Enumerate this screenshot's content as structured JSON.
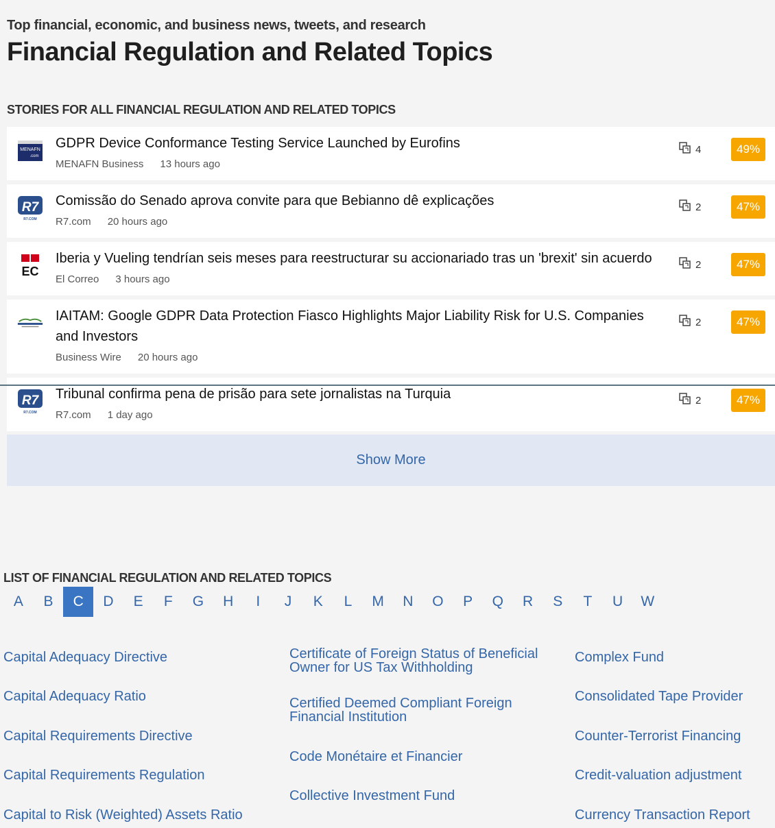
{
  "header": {
    "subtitle": "Top financial, economic, and business news, tweets, and research",
    "title": "Financial Regulation and Related Topics"
  },
  "stories_section": {
    "heading": "STORIES FOR ALL FINANCIAL REGULATION AND RELATED TOPICS",
    "show_more_label": "Show More",
    "stories": [
      {
        "title": "GDPR Device Conformance Testing Service Launched by Eurofins",
        "source": "MENAFN Business",
        "time": "13 hours ago",
        "count": "4",
        "percent": "49%",
        "logo": "menafn-logo"
      },
      {
        "title": "Comissão do Senado aprova convite para que Bebianno dê explicações",
        "source": "R7.com",
        "time": "20 hours ago",
        "count": "2",
        "percent": "47%",
        "logo": "r7-logo"
      },
      {
        "title": "Iberia y Vueling tendrían seis meses para reestructurar su accionariado tras un 'brexit' sin acuerdo",
        "source": "El Correo",
        "time": "3 hours ago",
        "count": "2",
        "percent": "47%",
        "logo": "el-correo-logo"
      },
      {
        "title": "IAITAM: Google GDPR Data Protection Fiasco Highlights Major Liability Risk for U.S. Companies and Investors",
        "source": "Business Wire",
        "time": "20 hours ago",
        "count": "2",
        "percent": "47%",
        "logo": "business-wire-logo"
      },
      {
        "title": "Tribunal confirma pena de prisão para sete jornalistas na Turquia",
        "source": "R7.com",
        "time": "1 day ago",
        "count": "2",
        "percent": "47%",
        "logo": "r7-logo"
      }
    ]
  },
  "logos": {
    "menafn": {
      "line1": "MENAFN",
      "line2": ".com"
    },
    "r7": {
      "main": "R7",
      "sub": "R7.COM"
    },
    "el_correo": {
      "text": "EC"
    }
  },
  "topics_section": {
    "heading": "LIST OF FINANCIAL REGULATION AND RELATED TOPICS",
    "letters": [
      "A",
      "B",
      "C",
      "D",
      "E",
      "F",
      "G",
      "H",
      "I",
      "J",
      "K",
      "L",
      "M",
      "N",
      "O",
      "P",
      "Q",
      "R",
      "S",
      "T",
      "U",
      "W"
    ],
    "active_letter": "C",
    "columns": [
      [
        "Capital Adequacy Directive",
        "Capital Adequacy Ratio",
        "Capital Requirements Directive",
        "Capital Requirements Regulation",
        "Capital to Risk (Weighted) Assets Ratio"
      ],
      [
        "Certificate of Foreign Status of Beneficial Owner for US Tax Withholding",
        "Certified Deemed Compliant Foreign Financial Institution",
        "Code Monétaire et Financier",
        "Collective Investment Fund"
      ],
      [
        "Complex Fund",
        "Consolidated Tape Provider",
        "Counter-Terrorist Financing",
        "Credit-valuation adjustment",
        "Currency Transaction Report"
      ]
    ]
  },
  "colors": {
    "accent": "#3466a8",
    "active_letter_bg": "#3a75c4",
    "percent_badge": "#f7a600",
    "show_more_bg": "#e1e8f4"
  }
}
